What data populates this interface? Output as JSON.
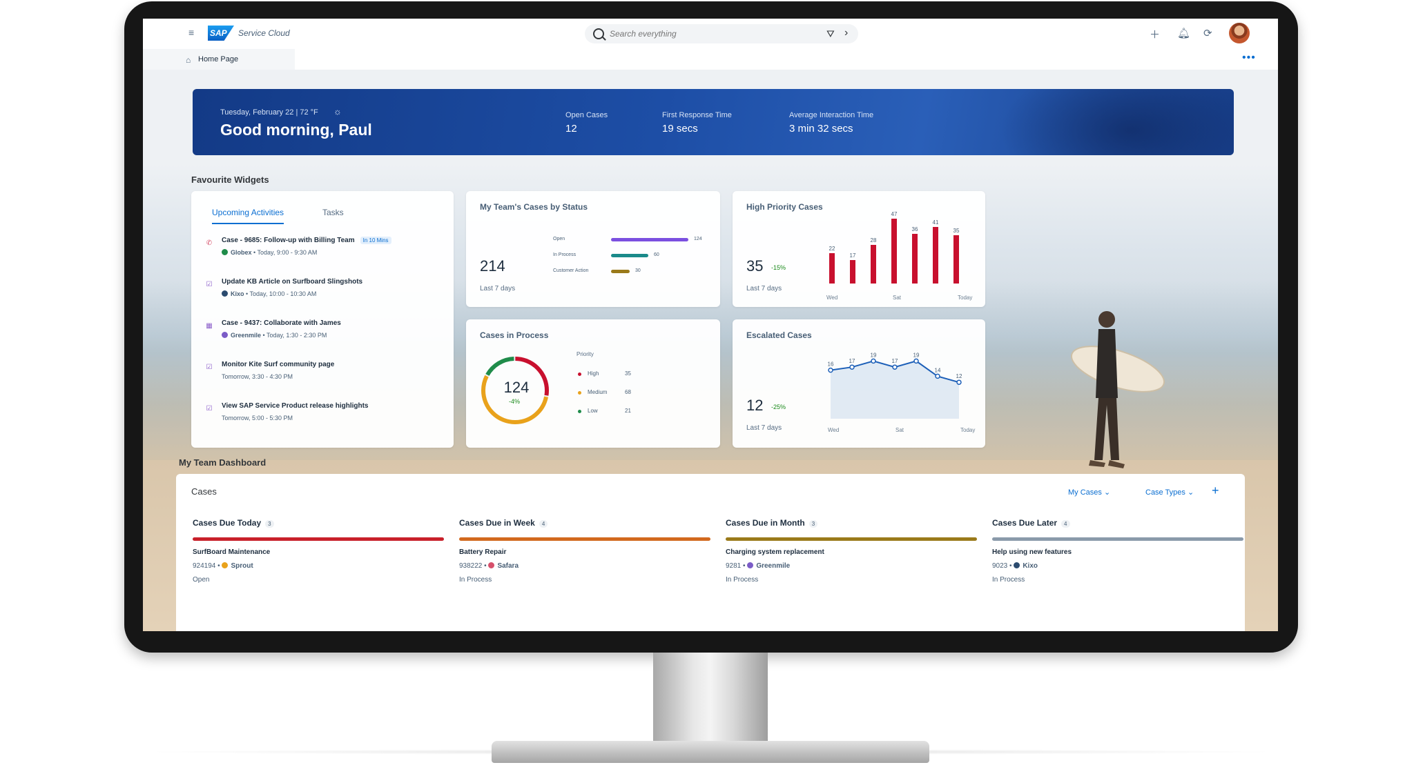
{
  "app": {
    "product_name": "Service Cloud",
    "logo_text": "SAP"
  },
  "search": {
    "placeholder": "Search everything"
  },
  "breadcrumb": {
    "home_label": "Home Page"
  },
  "banner": {
    "date_weather": "Tuesday, February 22 | 72 °F",
    "greeting": "Good morning, Paul",
    "kpis": [
      {
        "label": "Open Cases",
        "value": "12"
      },
      {
        "label": "First Response Time",
        "value": "19 secs"
      },
      {
        "label": "Average Interaction Time",
        "value": "3 min 32 secs"
      }
    ]
  },
  "favourites": {
    "title": "Favourite Widgets"
  },
  "activities": {
    "tabs": [
      "Upcoming Activities",
      "Tasks"
    ],
    "items": [
      {
        "title": "Case - 9685: Follow-up with Billing Team",
        "badge": "In 10 Mins",
        "org": "Globex",
        "time": "Today, 9:00 - 9:30 AM",
        "icon": "phone-icon",
        "org_color": "#1f8c4a"
      },
      {
        "title": "Update KB Article on Surfboard Slingshots",
        "badge": "",
        "org": "Kixo",
        "time": "Today, 10:00 - 10:30 AM",
        "icon": "task-icon",
        "org_color": "#2b4b6f"
      },
      {
        "title": "Case - 9437: Collaborate with James",
        "badge": "",
        "org": "Greenmile",
        "time": "Today, 1:30 - 2:30 PM",
        "icon": "calendar-icon",
        "org_color": "#7b5cc7"
      },
      {
        "title": "Monitor Kite Surf community page",
        "badge": "",
        "org": "",
        "time": "Tomorrow, 3:30 - 4:30 PM",
        "icon": "task-icon",
        "org_color": ""
      },
      {
        "title": "View SAP Service Product release highlights",
        "badge": "",
        "org": "",
        "time": "Tomorrow, 5:00 - 5:30 PM",
        "icon": "task-icon",
        "org_color": ""
      }
    ]
  },
  "cases_by_status": {
    "title": "My Team's Cases by Status",
    "total": "214",
    "period": "Last 7 days",
    "rows": [
      {
        "label": "Open",
        "value": 124,
        "color": "#7b4fe0"
      },
      {
        "label": "In Process",
        "value": 60,
        "color": "#1a8a8a"
      },
      {
        "label": "Customer Action",
        "value": 30,
        "color": "#9a7a1a"
      }
    ]
  },
  "high_priority": {
    "title": "High Priority Cases",
    "value": "35",
    "delta": "-15%",
    "period": "Last 7 days",
    "axis_labels": [
      "Wed",
      "Sat",
      "Today"
    ],
    "bar_color": "#c8102e"
  },
  "cases_in_process": {
    "title": "Cases in Process",
    "value": "124",
    "delta": "-4%",
    "legend_title": "Priority",
    "priorities": [
      {
        "label": "High",
        "value": 35,
        "color": "#c8102e"
      },
      {
        "label": "Medium",
        "value": 68,
        "color": "#e9a21b"
      },
      {
        "label": "Low",
        "value": 21,
        "color": "#1f8c4a"
      }
    ]
  },
  "escalated": {
    "title": "Escalated Cases",
    "value": "12",
    "delta": "-25%",
    "period": "Last 7 days",
    "axis_labels": [
      "Wed",
      "Sat",
      "Today"
    ],
    "line_color": "#1c5fb8"
  },
  "chart_data": [
    {
      "type": "bar",
      "title": "High Priority Cases",
      "values": [
        22,
        17,
        28,
        47,
        36,
        41,
        35
      ],
      "x_labels_shown": [
        "Wed",
        "Sat",
        "Today"
      ],
      "ylim": [
        0,
        50
      ]
    },
    {
      "type": "line",
      "title": "Escalated Cases",
      "values": [
        16,
        17,
        19,
        17,
        19,
        14,
        12
      ],
      "x_labels_shown": [
        "Wed",
        "Sat",
        "Today"
      ],
      "ylim": [
        0,
        20
      ]
    }
  ],
  "dashboard": {
    "section_title": "My Team Dashboard",
    "card_title": "Cases",
    "filters": [
      "My Cases",
      "Case Types"
    ],
    "columns": [
      {
        "title": "Cases Due Today",
        "count": "3",
        "color": "#c8202a",
        "case_title": "SurfBoard Maintenance",
        "case_id": "924194",
        "org": "Sprout",
        "org_color": "#e9a21b",
        "status": "Open"
      },
      {
        "title": "Cases Due in Week",
        "count": "4",
        "color": "#d2691e",
        "case_title": "Battery Repair",
        "case_id": "938222",
        "org": "Safara",
        "org_color": "#d6506b",
        "status": "In Process"
      },
      {
        "title": "Cases Due in Month",
        "count": "3",
        "color": "#9a7a1a",
        "case_title": "Charging system replacement",
        "case_id": "9281",
        "org": "Greenmile",
        "org_color": "#7b5cc7",
        "status": "In Process"
      },
      {
        "title": "Cases Due Later",
        "count": "4",
        "color": "#8a9aaa",
        "case_title": "Help using new features",
        "case_id": "9023",
        "org": "Kixo",
        "org_color": "#2b4b6f",
        "status": "In Process"
      }
    ]
  }
}
